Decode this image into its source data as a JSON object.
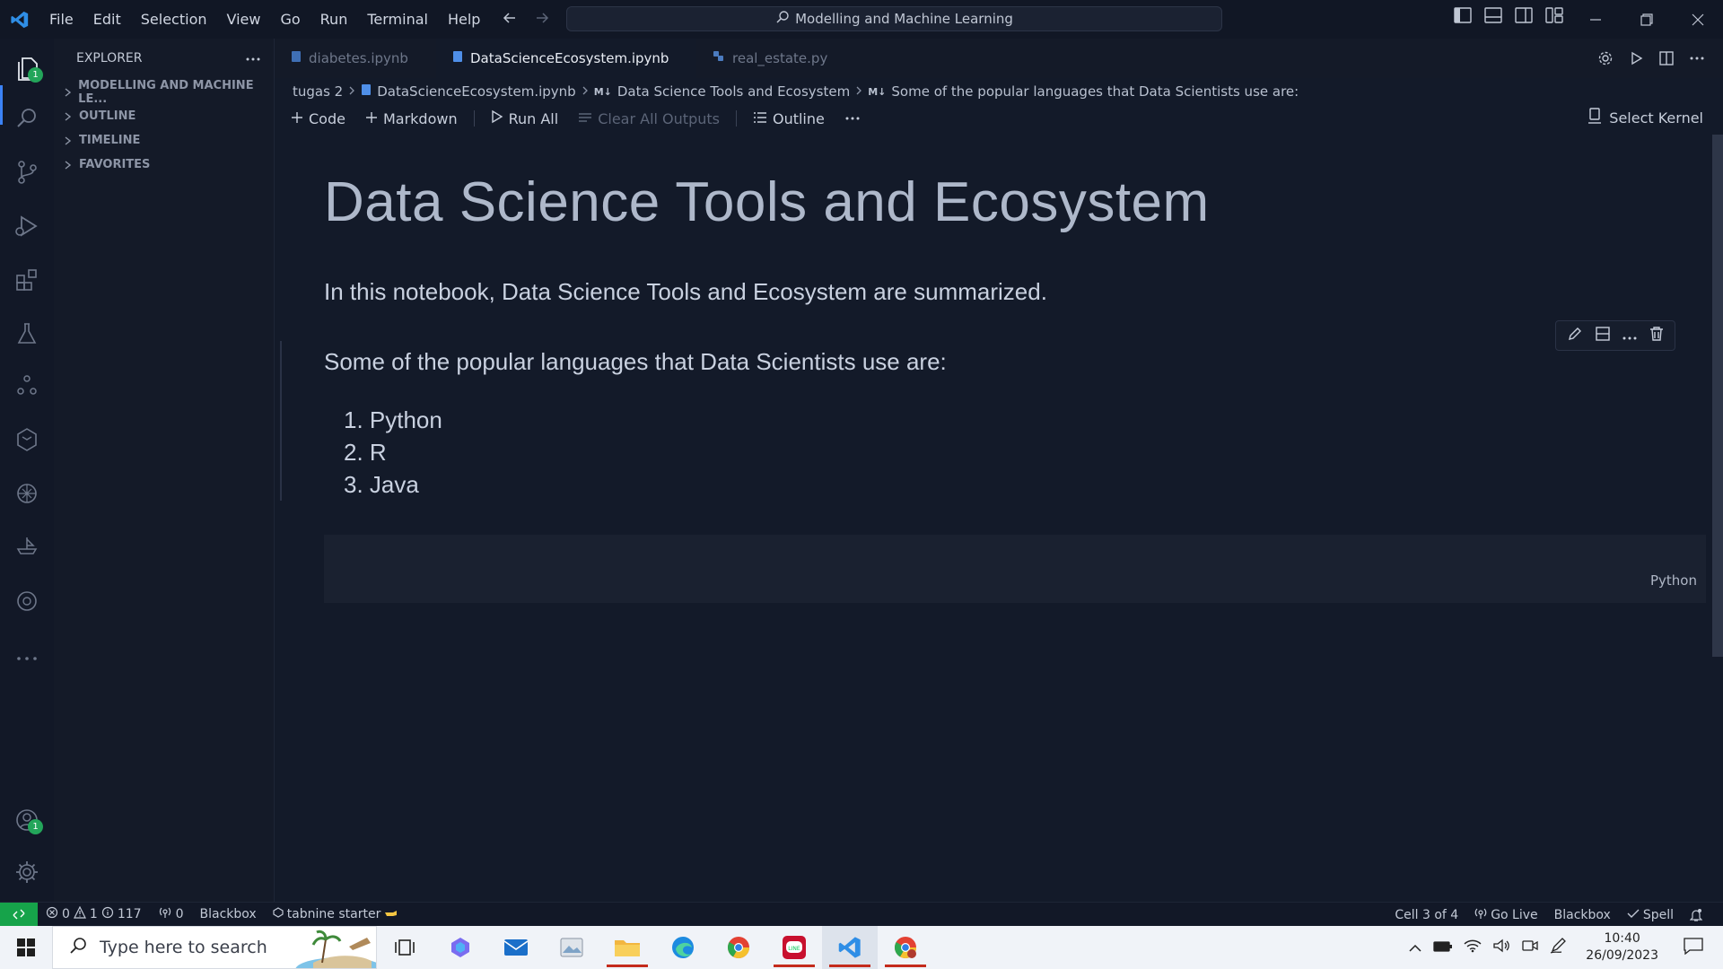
{
  "menu": [
    "File",
    "Edit",
    "Selection",
    "View",
    "Go",
    "Run",
    "Terminal",
    "Help"
  ],
  "search": {
    "text": "Modelling and Machine Learning"
  },
  "sidebar": {
    "title": "EXPLORER",
    "sections": [
      "MODELLING AND MACHINE LE...",
      "OUTLINE",
      "TIMELINE",
      "FAVORITES"
    ]
  },
  "activity": {
    "explorer_badge": "1",
    "accounts_badge": "1"
  },
  "tabs": [
    {
      "label": "diabetes.ipynb"
    },
    {
      "label": "DataScienceEcosystem.ipynb"
    },
    {
      "label": "real_estate.py"
    }
  ],
  "breadcrumb": {
    "folder": "tugas 2",
    "file": "DataScienceEcosystem.ipynb",
    "md_mark": "M↓",
    "heading": "Data Science Tools and Ecosystem",
    "section": "Some of the popular languages that Data Scientists use are:"
  },
  "toolbar": {
    "code": "Code",
    "markdown": "Markdown",
    "run_all": "Run All",
    "clear_outputs": "Clear All Outputs",
    "outline": "Outline",
    "kernel": "Select Kernel"
  },
  "notebook": {
    "title": "Data Science Tools and Ecosystem",
    "intro": "In this notebook, Data Science Tools and Ecosystem are summarized.",
    "languages_heading": "Some of the popular languages that Data Scientists use are:",
    "languages": [
      "1. Python",
      "2. R",
      "3. Java"
    ],
    "code_cell_lang": "Python"
  },
  "status": {
    "errors": "0",
    "warnings": "1",
    "info": "117",
    "ports": "0",
    "blackbox_left": "Blackbox",
    "tabnine": "tabnine starter",
    "cell": "Cell 3 of 4",
    "go_live": "Go Live",
    "blackbox_right": "Blackbox",
    "spell": "Spell"
  },
  "taskbar": {
    "search_placeholder": "Type here to search",
    "time": "10:40",
    "date": "26/09/2023"
  },
  "colors": {
    "accent": "#3b82f6",
    "status_green": "#16a34a",
    "badge": "#23a55a"
  }
}
